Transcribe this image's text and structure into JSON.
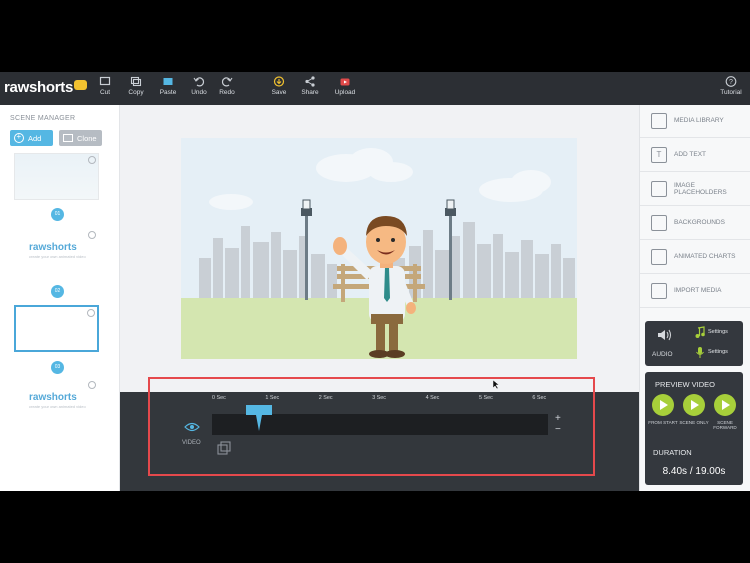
{
  "app": {
    "logo": "rawshorts",
    "badge_colors": {
      "accent": "#55b7e3",
      "play": "#a7cf3a",
      "badge": "#f2c230",
      "highlight": "#e5494c"
    }
  },
  "toolbar": {
    "items": [
      {
        "label": "Cut",
        "icon": "cut-icon"
      },
      {
        "label": "Copy",
        "icon": "copy-icon"
      },
      {
        "label": "Paste",
        "icon": "paste-icon"
      },
      {
        "label": "Undo",
        "icon": "undo-icon"
      },
      {
        "label": "Redo",
        "icon": "redo-icon"
      },
      {
        "label": "Save",
        "icon": "save-icon"
      },
      {
        "label": "Share",
        "icon": "share-icon"
      },
      {
        "label": "Upload",
        "icon": "youtube-upload-icon"
      }
    ],
    "tutorial": "Tutorial"
  },
  "scene_manager": {
    "title": "SCENE MANAGER",
    "add_label": "Add",
    "clone_label": "Clone",
    "scenes": [
      {
        "dot": "01",
        "content": "sky"
      },
      {
        "dot": "02",
        "content": "rawshorts",
        "logo": "rawshorts",
        "tagline": "create your own animated video"
      },
      {
        "dot": "03",
        "content": "blank"
      },
      {
        "dot": "04",
        "content": "rawshorts",
        "logo": "rawshorts",
        "tagline": "create your own animated video"
      }
    ]
  },
  "right_panel": {
    "items": [
      {
        "label": "MEDIA LIBRARY",
        "icon": "media-library-icon"
      },
      {
        "label": "ADD TEXT",
        "icon": "text-icon"
      },
      {
        "label": "IMAGE PLACEHOLDERS",
        "icon": "image-placeholder-icon"
      },
      {
        "label": "BACKGROUNDS",
        "icon": "backgrounds-icon"
      },
      {
        "label": "ANIMATED CHARTS",
        "icon": "chart-icon"
      },
      {
        "label": "IMPORT MEDIA",
        "icon": "import-icon"
      }
    ],
    "audio": {
      "label": "AUDIO",
      "music_settings": "Settings",
      "voice_settings": "Settings"
    },
    "preview": {
      "title": "PREVIEW VIDEO",
      "buttons": [
        {
          "label": "FROM START"
        },
        {
          "label": "SCENE ONLY"
        },
        {
          "label": "SCENE FORWARD"
        }
      ],
      "duration_title": "DURATION",
      "duration_value": "8.40s / 19.00s"
    }
  },
  "timeline": {
    "track_label": "VIDEO",
    "ticks": [
      "0 Sec",
      "1 Sec",
      "2 Sec",
      "3 Sec",
      "4 Sec",
      "5 Sec",
      "6 Sec"
    ],
    "zoom_in": "+",
    "zoom_out": "−",
    "playhead_seconds": 0.5
  }
}
